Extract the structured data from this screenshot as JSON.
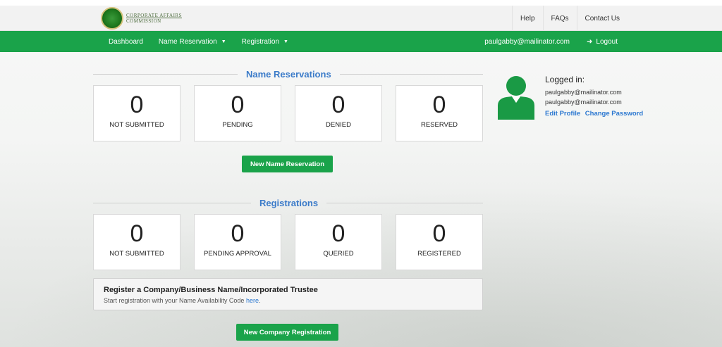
{
  "logo": {
    "line1": "CORPORATE AFFAIRS",
    "line2": "COMMISSION"
  },
  "top_nav": {
    "links": [
      "Help",
      "FAQs",
      "Contact Us"
    ]
  },
  "main_nav": {
    "dashboard": "Dashboard",
    "name_reservation": "Name Reservation",
    "registration": "Registration",
    "user_email": "paulgabby@mailinator.com",
    "logout": "Logout"
  },
  "name_reservations": {
    "title": "Name Reservations",
    "cards": [
      {
        "value": "0",
        "label": "NOT SUBMITTED"
      },
      {
        "value": "0",
        "label": "PENDING"
      },
      {
        "value": "0",
        "label": "DENIED"
      },
      {
        "value": "0",
        "label": "RESERVED"
      }
    ],
    "button": "New Name Reservation"
  },
  "registrations": {
    "title": "Registrations",
    "cards": [
      {
        "value": "0",
        "label": "NOT SUBMITTED"
      },
      {
        "value": "0",
        "label": "PENDING APPROVAL"
      },
      {
        "value": "0",
        "label": "QUERIED"
      },
      {
        "value": "0",
        "label": "REGISTERED"
      }
    ],
    "register_title": "Register a Company/Business Name/Incorporated Trustee",
    "register_text": "Start registration with your Name Availability Code",
    "register_link": "here",
    "register_period": ".",
    "button": "New Company Registration"
  },
  "profile": {
    "title": "Logged in:",
    "email1": "paulgabby@mailinator.com",
    "email2": "paulgabby@mailinator.com",
    "edit_profile": "Edit Profile",
    "change_password": "Change Password"
  },
  "colors": {
    "brand_green": "#1aa34a",
    "link_blue": "#2b78d0",
    "section_blue": "#3b7bc9"
  }
}
